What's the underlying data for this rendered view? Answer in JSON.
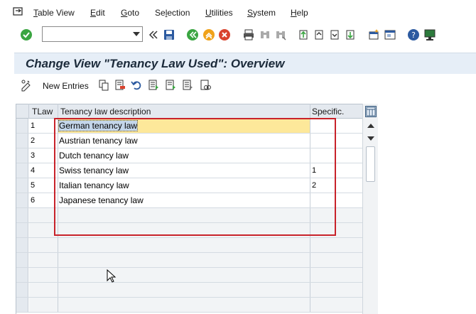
{
  "menu": {
    "items": [
      {
        "label": "Table View",
        "underline": "T"
      },
      {
        "label": "Edit",
        "underline": "E"
      },
      {
        "label": "Goto",
        "underline": "G"
      },
      {
        "label": "Selection",
        "underline": "l"
      },
      {
        "label": "Utilities",
        "underline": "U"
      },
      {
        "label": "System",
        "underline": "S"
      },
      {
        "label": "Help",
        "underline": "H"
      }
    ]
  },
  "toolbar": {
    "command_value": ""
  },
  "screen": {
    "title": "Change View \"Tenancy Law Used\": Overview"
  },
  "app_toolbar": {
    "new_entries_label": "New Entries"
  },
  "table": {
    "headers": [
      "TLaw",
      "Tenancy law description",
      "Specific."
    ],
    "rows": [
      {
        "tlaw": "1",
        "description": "German tenancy law",
        "specific": ""
      },
      {
        "tlaw": "2",
        "description": "Austrian tenancy law",
        "specific": ""
      },
      {
        "tlaw": "3",
        "description": "Dutch tenancy law",
        "specific": ""
      },
      {
        "tlaw": "4",
        "description": "Swiss tenancy law",
        "specific": "1"
      },
      {
        "tlaw": "5",
        "description": "Italian tenancy law",
        "specific": "2"
      },
      {
        "tlaw": "6",
        "description": "Japanese tenancy law",
        "specific": ""
      }
    ]
  },
  "colors": {
    "highlight": "#c8222a",
    "focused_cell": "#fde89a",
    "title_bar": "#e6eef7"
  }
}
